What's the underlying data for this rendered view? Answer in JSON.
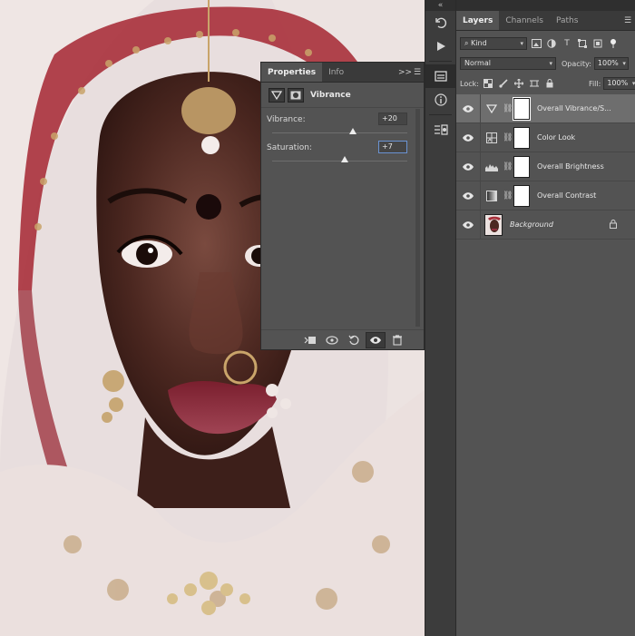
{
  "properties": {
    "tabs": [
      "Properties",
      "Info"
    ],
    "collapse_glyph": ">>",
    "adjustment_title": "Vibrance",
    "sliders": [
      {
        "label": "Vibrance:",
        "value": "+20",
        "level": 0.6
      },
      {
        "label": "Saturation:",
        "value": "+7",
        "level": 0.535
      }
    ]
  },
  "layers_panel": {
    "tabs": [
      "Layers",
      "Channels",
      "Paths"
    ],
    "filter": {
      "label": "Kind"
    },
    "blend_mode": "Normal",
    "opacity": {
      "label": "Opacity:",
      "value": "100%"
    },
    "lock": {
      "label": "Lock:"
    },
    "fill": {
      "label": "Fill:",
      "value": "100%"
    },
    "layers": [
      {
        "name": "Overall Vibrance/S...",
        "type": "vibrance",
        "selected": true
      },
      {
        "name": "Color Look",
        "type": "color-lookup",
        "selected": false
      },
      {
        "name": "Overall Brightness",
        "type": "levels",
        "selected": false
      },
      {
        "name": "Overall Contrast",
        "type": "gradient-map",
        "selected": false
      },
      {
        "name": "Background",
        "type": "image",
        "selected": false
      }
    ]
  },
  "colors": {
    "panel": "#535353",
    "panel_dark": "#3a3a3a",
    "selected_layer": "#6e6e6e",
    "lip": "#8d2d3c",
    "veil_red": "#a8303b"
  }
}
